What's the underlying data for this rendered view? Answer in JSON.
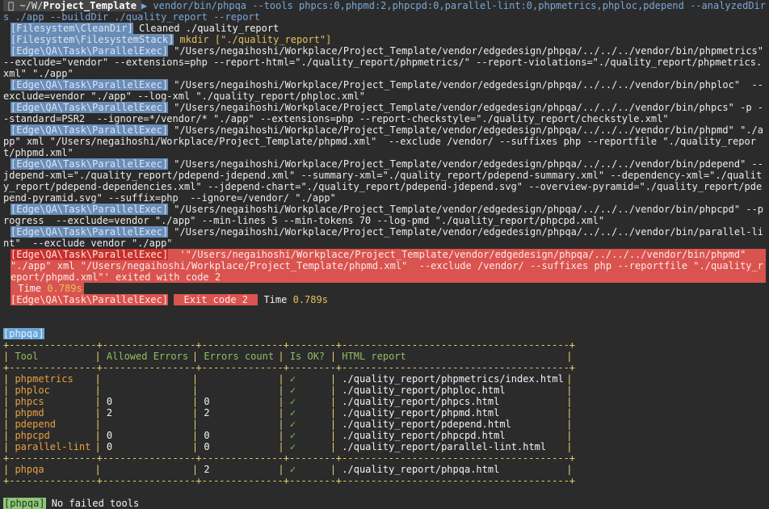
{
  "prompt": {
    "path": "~/W/",
    "dir": "Project_Template",
    "command": "vendor/bin/phpqa --tools phpcs:0,phpmd:2,phpcpd:0,parallel-lint:0,phpmetrics,phploc,pdepend --analyzedDirs ./app --buildDir ./quality_report --report"
  },
  "log": [
    {
      "tag": "[Filesystem\\CleanDir]",
      "text": " Cleaned ./quality_report"
    },
    {
      "tag": "[Filesystem\\FilesystemStack]",
      "text": " mkdir [\"./quality_report\"]"
    },
    {
      "tag": "[Edge\\QA\\Task\\ParallelExec]",
      "text": " \"/Users/negaihoshi/Workplace/Project_Template/vendor/edgedesign/phpqa/../../../vendor/bin/phpmetrics\"  --exclude=\"vendor\" --extensions=php --report-html=\"./quality_report/phpmetrics/\" --report-violations=\"./quality_report/phpmetrics.xml\" \"./app\""
    },
    {
      "tag": "[Edge\\QA\\Task\\ParallelExec]",
      "text": " \"/Users/negaihoshi/Workplace/Project_Template/vendor/edgedesign/phpqa/../../../vendor/bin/phploc\"  --exclude=vendor \"./app\" --log-xml \"./quality_report/phploc.xml\""
    },
    {
      "tag": "[Edge\\QA\\Task\\ParallelExec]",
      "text": " \"/Users/negaihoshi/Workplace/Project_Template/vendor/edgedesign/phpqa/../../../vendor/bin/phpcs\" -p --standard=PSR2  --ignore=*/vendor/* \"./app\" --extensions=php --report-checkstyle=\"./quality_report/checkstyle.xml\""
    },
    {
      "tag": "[Edge\\QA\\Task\\ParallelExec]",
      "text": " \"/Users/negaihoshi/Workplace/Project_Template/vendor/edgedesign/phpqa/../../../vendor/bin/phpmd\" \"./app\" xml \"/Users/negaihoshi/Workplace/Project_Template/phpmd.xml\"  --exclude /vendor/ --suffixes php --reportfile \"./quality_report/phpmd.xml\""
    },
    {
      "tag": "[Edge\\QA\\Task\\ParallelExec]",
      "text": " \"/Users/negaihoshi/Workplace/Project_Template/vendor/edgedesign/phpqa/../../../vendor/bin/pdepend\" --jdepend-xml=\"./quality_report/pdepend-jdepend.xml\" --summary-xml=\"./quality_report/pdepend-summary.xml\" --dependency-xml=\"./quality_report/pdepend-dependencies.xml\" --jdepend-chart=\"./quality_report/pdepend-jdepend.svg\" --overview-pyramid=\"./quality_report/pdepend-pyramid.svg\" --suffix=php  --ignore=/vendor/ \"./app\""
    },
    {
      "tag": "[Edge\\QA\\Task\\ParallelExec]",
      "text": " \"/Users/negaihoshi/Workplace/Project_Template/vendor/edgedesign/phpqa/../../../vendor/bin/phpcpd\" --progress  --exclude=vendor \"./app\" --min-lines 5 --min-tokens 70 --log-pmd \"./quality_report/phpcpd.xml\""
    },
    {
      "tag": "[Edge\\QA\\Task\\ParallelExec]",
      "text": " \"/Users/negaihoshi/Workplace/Project_Template/vendor/edgedesign/phpqa/../../../vendor/bin/parallel-lint\"  --exclude vendor \"./app\""
    }
  ],
  "error": {
    "tag": "[Edge\\QA\\Task\\ParallelExec]",
    "text": "  '\"/Users/negaihoshi/Workplace/Project_Template/vendor/edgedesign/phpqa/../../../vendor/bin/phpmd\" \"./app\" xml \"/Users/negaihoshi/Workplace/Project_Template/phpmd.xml\"  --exclude /vendor/ --suffixes php --reportfile \"./quality_report/phpmd.xml\"' exited with code 2",
    "time_label": " Time ",
    "time_value": "0.789s",
    "exit_tag": "[Edge\\QA\\Task\\ParallelExec]",
    "exit_code": " Exit code 2 ",
    "exit_time_label": " Time ",
    "exit_time_value": "0.789s"
  },
  "phpqa_tag": "[phpqa]",
  "table": {
    "border": "+---------------+----------------+--------------+--------+---------------------------------------+",
    "headers": [
      "Tool",
      "Allowed Errors",
      "Errors count",
      "Is OK?",
      "HTML report"
    ],
    "rows": [
      [
        "phpmetrics",
        "",
        "",
        "✓",
        "./quality_report/phpmetrics/index.html"
      ],
      [
        "phploc",
        "",
        "",
        "✓",
        "./quality_report/phploc.html"
      ],
      [
        "phpcs",
        "0",
        "0",
        "✓",
        "./quality_report/phpcs.html"
      ],
      [
        "phpmd",
        "2",
        "2",
        "✓",
        "./quality_report/phpmd.html"
      ],
      [
        "pdepend",
        "",
        "",
        "✓",
        "./quality_report/pdepend.html"
      ],
      [
        "phpcpd",
        "0",
        "0",
        "✓",
        "./quality_report/phpcpd.html"
      ],
      [
        "parallel-lint",
        "0",
        "0",
        "✓",
        "./quality_report/parallel-lint.html"
      ]
    ],
    "total": [
      "phpqa",
      "",
      "2",
      "✓",
      "./quality_report/phpqa.html"
    ]
  },
  "footer": {
    "tag": "[phpqa]",
    "text": " No failed tools"
  }
}
